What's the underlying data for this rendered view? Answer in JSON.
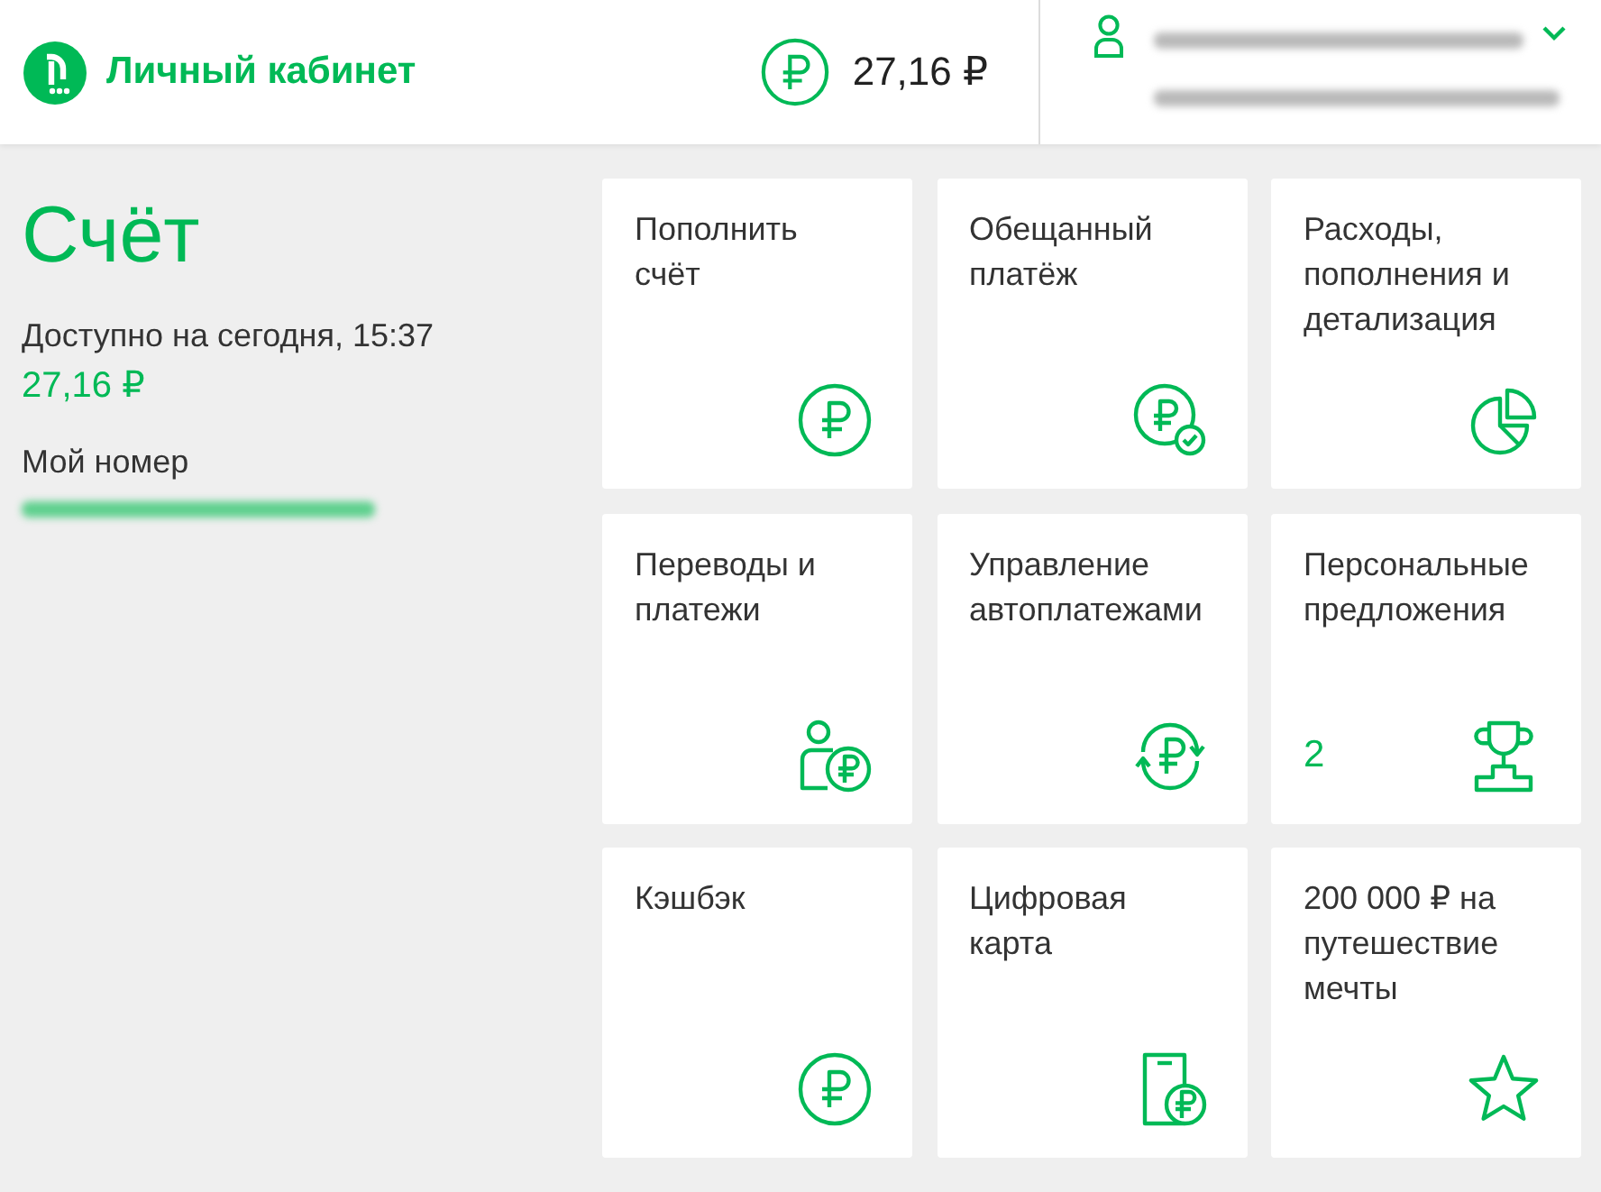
{
  "header": {
    "site_title": "Личный кабинет",
    "balance": "27,16 ₽"
  },
  "account": {
    "title": "Счёт",
    "available_label": "Доступно на сегодня, 15:37",
    "available_amount": "27,16 ₽",
    "number_label": "Мой номер"
  },
  "tiles": [
    {
      "title": "Пополнить\nсчёт",
      "kind": "ruble"
    },
    {
      "title": "Обещанный\nплатёж",
      "kind": "ruble-check"
    },
    {
      "title": "Расходы,\nпополнения и\nдетализация",
      "kind": "pie"
    },
    {
      "title": "Переводы и\nплатежи",
      "kind": "person-ruble"
    },
    {
      "title": "Управление\nавтоплатежами",
      "kind": "autopay"
    },
    {
      "title": "Персональные\nпредложения",
      "kind": "trophy",
      "badge": "2"
    },
    {
      "title": "Кэшбэк",
      "kind": "ruble"
    },
    {
      "title": "Цифровая\nкарта",
      "kind": "phone-ruble"
    },
    {
      "title": "200 000 ₽ на\nпутешествие\nмечты",
      "kind": "star"
    }
  ]
}
